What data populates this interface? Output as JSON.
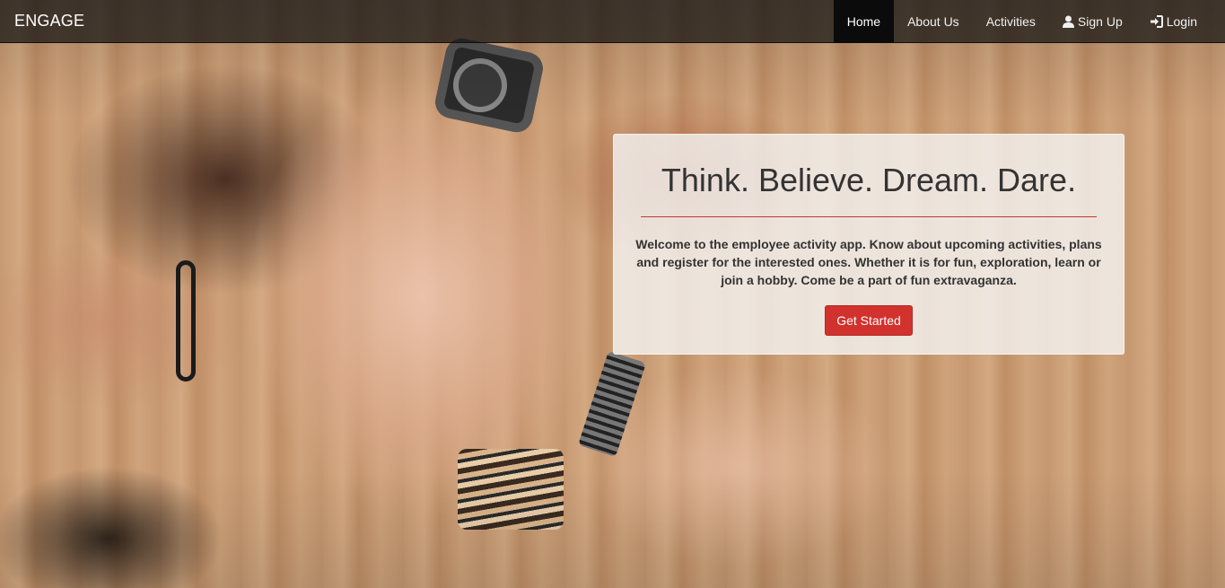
{
  "navbar": {
    "brand": "ENGAGE",
    "items": [
      {
        "label": "Home",
        "active": true,
        "icon": ""
      },
      {
        "label": "About Us",
        "active": false,
        "icon": ""
      },
      {
        "label": "Activities",
        "active": false,
        "icon": ""
      },
      {
        "label": "Sign Up",
        "active": false,
        "icon": "user-icon"
      },
      {
        "label": "Login",
        "active": false,
        "icon": "login-icon"
      }
    ]
  },
  "hero": {
    "title": "Think. Believe. Dream. Dare.",
    "text": "Welcome to the employee activity app. Know about upcoming activities, plans and register for the interested ones. Whether it is for fun, exploration, learn or join a hobby. Come be a part of fun extravaganza.",
    "button_label": "Get Started"
  },
  "colors": {
    "accent": "#d1322d",
    "navbar_bg": "#141414",
    "rule": "#c0392b"
  }
}
